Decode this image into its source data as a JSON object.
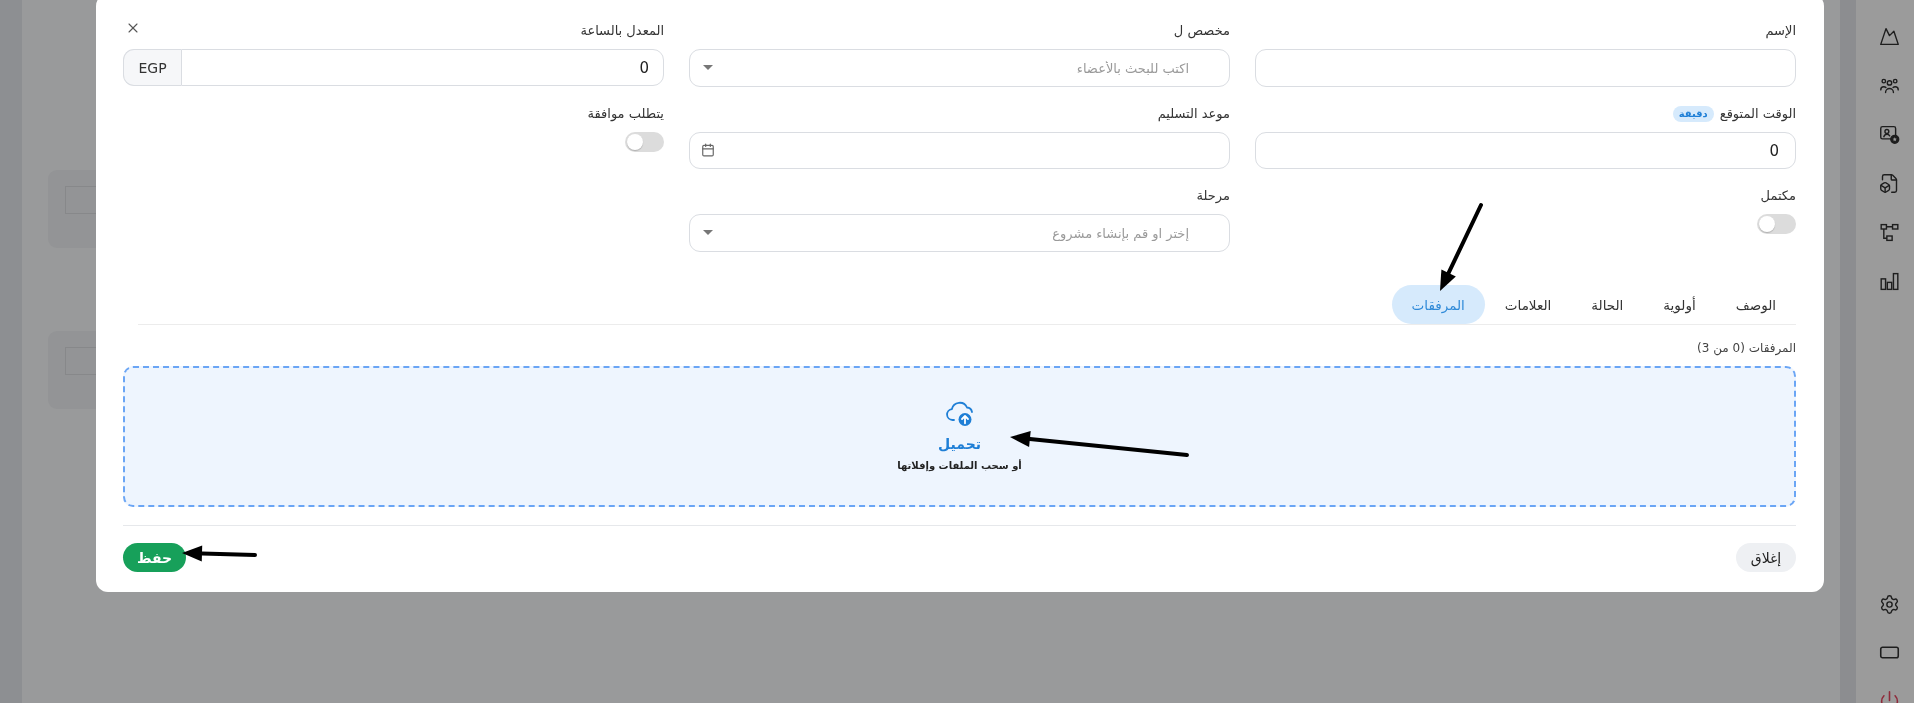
{
  "dialog": {
    "fields": [
      {
        "kind": "text",
        "label": "الإسم"
      },
      {
        "kind": "select",
        "label": "مخصص ل",
        "placeholder": "اكتب للبحث بالأعضاء"
      },
      {
        "kind": "currency",
        "label": "المعدل بالساعة",
        "value": "0",
        "unit": "EGP"
      },
      {
        "kind": "number",
        "label": "الوقت المتوقع",
        "badge": "دقيقة",
        "value": "0"
      },
      {
        "kind": "date",
        "label": "موعد التسليم"
      },
      {
        "kind": "toggle",
        "label": "يتطلب موافقة",
        "on": false
      },
      {
        "kind": "toggle",
        "label": "مكتمل",
        "on": false
      },
      {
        "kind": "select",
        "label": "مرحلة",
        "placeholder": "إختر او قم بإنشاء مشروع"
      }
    ],
    "tabs": [
      {
        "label": "الوصف",
        "selected": false
      },
      {
        "label": "أولوية",
        "selected": false
      },
      {
        "label": "الحالة",
        "selected": false
      },
      {
        "label": "العلامات",
        "selected": false
      },
      {
        "label": "المرفقات",
        "selected": true
      }
    ],
    "attachments": {
      "label": "المرفقات (0 من 3)",
      "dropzone": {
        "title": "تحميل",
        "hint": "أو سحب الملفات وإفلاتها"
      }
    },
    "buttons": [
      {
        "kind": "secondary",
        "label": "إغلاق"
      },
      {
        "kind": "primary",
        "label": "حفظ"
      }
    ]
  }
}
